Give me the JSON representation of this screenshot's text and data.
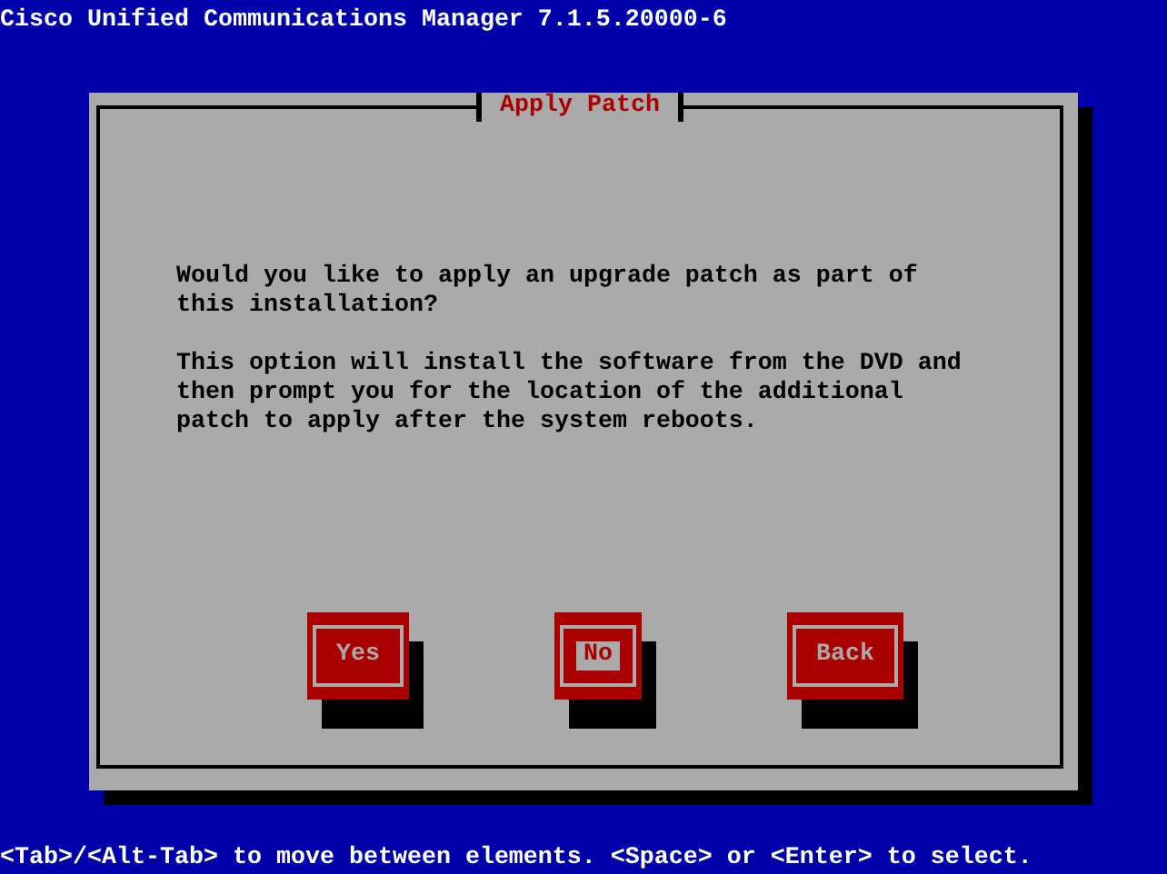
{
  "header": "Cisco Unified Communications Manager 7.1.5.20000-6",
  "dialog": {
    "title": "Apply Patch",
    "paragraphs": [
      [
        "Would you like to apply an upgrade patch as part of",
        "this installation?"
      ],
      [
        "This option will install the software from the DVD and",
        "then prompt you for the location of the additional",
        "patch to apply after the system reboots."
      ]
    ],
    "buttons": [
      {
        "label": "Yes",
        "selected": false
      },
      {
        "label": "No",
        "selected": true
      },
      {
        "label": "Back",
        "selected": false
      }
    ]
  },
  "status_bar": "<Tab>/<Alt-Tab> to move between elements. <Space> or <Enter> to select."
}
